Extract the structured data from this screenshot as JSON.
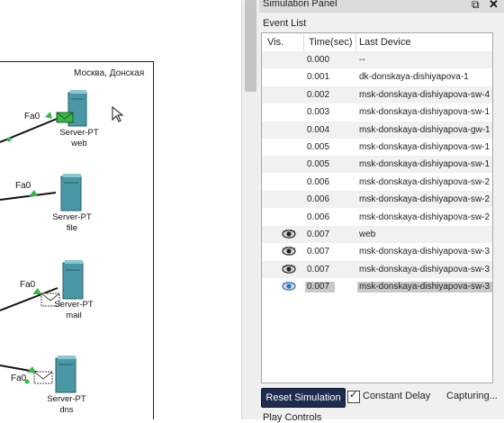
{
  "workspace": {
    "area_label": "Москва, Донская",
    "servers": [
      {
        "label": "Server-PT",
        "name": "web",
        "port": "Fa0"
      },
      {
        "label": "Server-PT",
        "name": "file",
        "port": "Fa0"
      },
      {
        "label": "Server-PT",
        "name": "mail",
        "port": "Fa0"
      },
      {
        "label": "Server-PT",
        "name": "dns",
        "port": "Fa0"
      }
    ]
  },
  "panel": {
    "title": "Simulation Panel",
    "event_list_label": "Event List",
    "columns": {
      "vis": "Vis.",
      "time": "Time(sec)",
      "device": "Last Device"
    },
    "events": [
      {
        "time": "0.000",
        "device": "--",
        "vis": false
      },
      {
        "time": "0.001",
        "device": "dk-donskaya-dishiyapova-1",
        "vis": false
      },
      {
        "time": "0.002",
        "device": "msk-donskaya-dishiyapova-sw-4",
        "vis": false
      },
      {
        "time": "0.003",
        "device": "msk-donskaya-dishiyapova-sw-1",
        "vis": false
      },
      {
        "time": "0.004",
        "device": "msk-donskaya-dishiyapova-gw-1",
        "vis": false
      },
      {
        "time": "0.005",
        "device": "msk-donskaya-dishiyapova-sw-1",
        "vis": false
      },
      {
        "time": "0.005",
        "device": "msk-donskaya-dishiyapova-sw-1",
        "vis": false
      },
      {
        "time": "0.006",
        "device": "msk-donskaya-dishiyapova-sw-2",
        "vis": false
      },
      {
        "time": "0.006",
        "device": "msk-donskaya-dishiyapova-sw-2",
        "vis": false
      },
      {
        "time": "0.006",
        "device": "msk-donskaya-dishiyapova-sw-2",
        "vis": false
      },
      {
        "time": "0.007",
        "device": "web",
        "vis": true
      },
      {
        "time": "0.007",
        "device": "msk-donskaya-dishiyapova-sw-3",
        "vis": true
      },
      {
        "time": "0.007",
        "device": "msk-donskaya-dishiyapova-sw-3",
        "vis": true
      },
      {
        "time": "0.007",
        "device": "msk-donskaya-dishiyapova-sw-3",
        "vis": true,
        "selected": true
      }
    ],
    "reset_label": "Reset Simulation",
    "constant_delay_label": "Constant Delay",
    "constant_delay_checked": true,
    "capturing_label": "Capturing...",
    "play_controls_label": "Play Controls"
  },
  "colors": {
    "server_teal": "#4a97a6",
    "link_green": "#3ab54a",
    "reset_button": "#1f2c4e"
  }
}
